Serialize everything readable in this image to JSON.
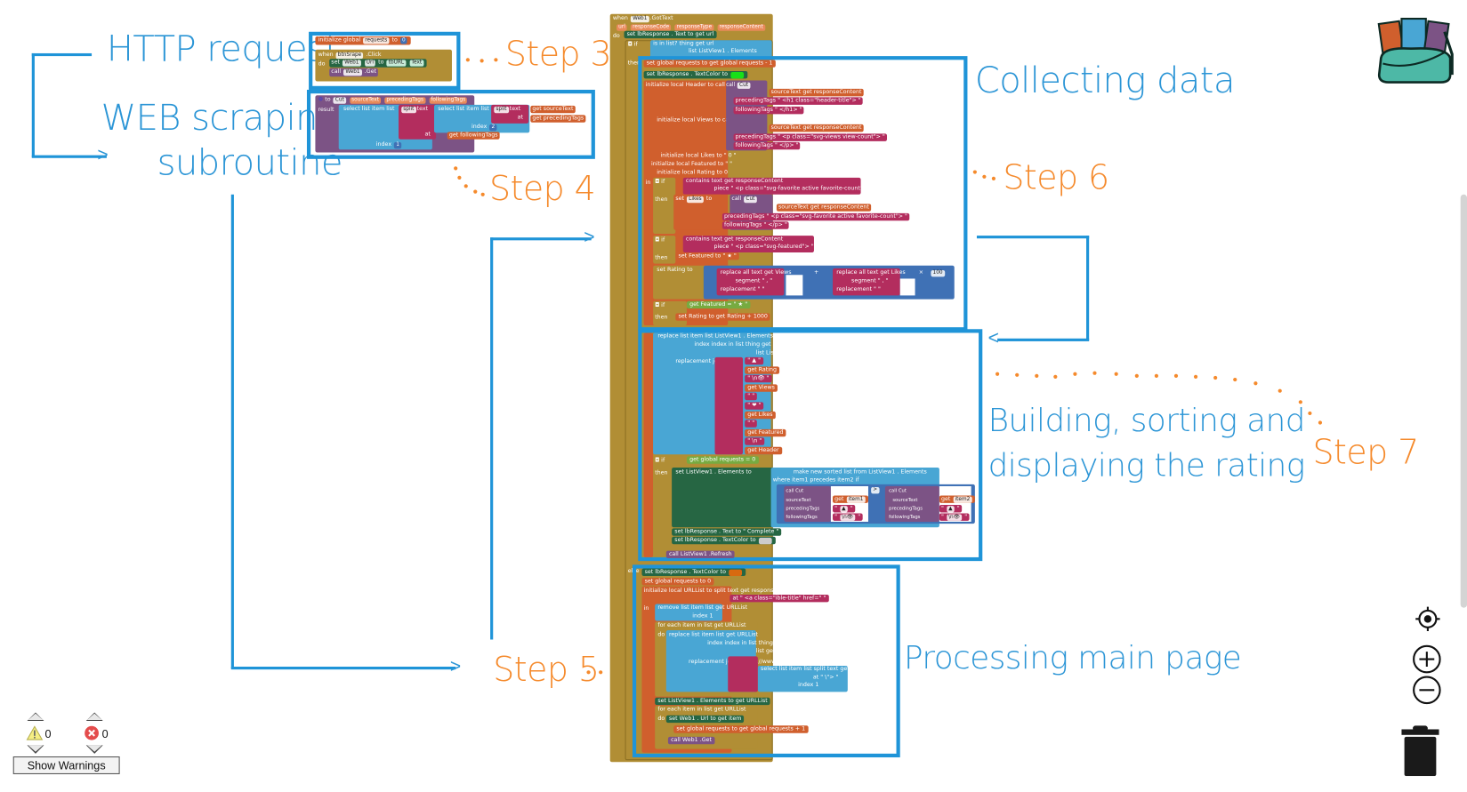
{
  "annotations": {
    "http_request": "HTTP request",
    "web_scraping_line1": "WEB scraping",
    "web_scraping_line2": "subroutine",
    "step3": "Step 3",
    "step4": "Step 4",
    "step5": "Step 5",
    "step6": "Step 6",
    "step7": "Step 7",
    "collecting_data": "Collecting data",
    "building_line1": "Building, sorting and",
    "building_line2": "displaying the rating",
    "processing_main_page": "Processing main page"
  },
  "colors": {
    "frame_blue": "#1f94d8",
    "step_orange": "#f58a2c",
    "control": "#b18e35",
    "variable": "#d05f2d",
    "procedure": "#7c5385",
    "list": "#49a6d4",
    "text": "#b32d5e",
    "math": "#3f71b5",
    "logic": "#77ab41",
    "component": "#266643"
  },
  "blocks": {
    "global_init": {
      "label": "initialize global",
      "var": "requests",
      "to": "to",
      "value": "0"
    },
    "btn_click": {
      "when": "when",
      "component": "btnSrape",
      "event": ".Click",
      "do": "do",
      "set": "set",
      "web": "Web1",
      "url": "Url",
      "to": "to",
      "tburl": "tbURL",
      "text": "Text",
      "call": "call",
      "get": ".Get"
    },
    "cut_proc": {
      "to": "to",
      "name": "Cut",
      "p1": "sourceText",
      "p2": "precedingTags",
      "p3": "followingTags",
      "result": "result",
      "select": "select list item  list",
      "split": "split",
      "text": "text",
      "index": "index",
      "at": "at",
      "get_source": "get sourceText",
      "get_preceding": "get precedingTags",
      "get_following": "get followingTags",
      "idx2": "2",
      "idx1": "1"
    },
    "gottext": {
      "when": "when",
      "component": "Web1",
      "event": ".GotText",
      "params": [
        "url",
        "responseCode",
        "responseType",
        "responseContent"
      ],
      "set_response_text": "set  lbResponse . Text  to  get url",
      "if_is_in_list": "is in list? thing  get url",
      "list_elements": "list  ListView1 . Elements",
      "set_global_requests": "set global requests to  get global requests  -  1",
      "set_text_color_green": "set  lbResponse . TextColor  to",
      "init_header": "initialize local Header to  call Cut",
      "header_source": "sourceText  get responseContent",
      "header_preceding": "precedingTags  \" <h1 class=\"header-title\"> \"",
      "header_following": "followingTags  \" </h1> \"",
      "init_views": "initialize local Views to  call Cut",
      "views_source": "sourceText  get responseContent",
      "views_preceding": "precedingTags  \" <p class=\"svg-views view-count\"> \"",
      "views_following": "followingTags  \" </p> \"",
      "init_likes": "initialize local Likes to \" 0 \"",
      "init_featured": "initialize local Featured to \" \"",
      "init_rating": "initialize local Rating to 0",
      "if_contains_likes": "contains text  get responseContent",
      "piece_likes": "piece  \" <p class=\"svg-favorite active favorite-count\"> \"",
      "set_likes": "set Likes to  call Cut",
      "likes_source": "sourceText  get responseContent",
      "likes_preceding": "precedingTags  \" <p class=\"svg-favorite active favorite-count\"> \"",
      "likes_following": "followingTags  \" </p> \"",
      "if_contains_featured": "contains text  get responseContent",
      "piece_featured": "piece  \" <p class=\"svg-featured\"> \"",
      "set_featured": "set Featured to \" ★ \"",
      "set_rating": "set Rating to",
      "replace_views": "replace all text  get Views",
      "replace_likes": "replace all text  get Likes",
      "segment": "segment \" , \"",
      "replacement": "replacement \" \"",
      "multiplier": "100",
      "if_featured": "get Featured  =  \" ★ \"",
      "rating_bonus": "set Rating to  get Rating  +  1000",
      "replace_list_item": "replace list item  list  ListView1 . Elements",
      "index_in_list": "index  index in list  thing  get url",
      "list2": "list  ListView1 . Elements",
      "replacement_join": "replacement  join",
      "join_items": [
        "\" ▲ \"",
        "get Rating",
        "\" \\n👁 \"",
        "get Views",
        "\" \"",
        "\" ❤ \"",
        "get Likes",
        "\" \"",
        "get Featured",
        "\" \\n \"",
        "get Header"
      ],
      "if_requests_zero": "get global requests  =  0",
      "set_sorted": "set  ListView1 . Elements  to",
      "make_sorted": "make new sorted list from  ListView1 . Elements",
      "where": "where  item1  precedes  item2  if",
      "cut_item1": "call Cut  sourceText get item1  precedingTags \" ▲ \"  followingTags \" \\n👁 \"",
      "compare": ">",
      "cut_item2": "call Cut  sourceText get item2  precedingTags \" ▲ \"  followingTags \" \\n👁 \"",
      "set_complete": "set  lbResponse . Text  to \" Complete \"",
      "set_color_gray": "set  lbResponse . TextColor  to",
      "refresh": "call  ListView1 .Refresh",
      "else_color_orange": "set  lbResponse . TextColor  to",
      "else_requests": "set global requests to 0",
      "init_urllist": "initialize local URLList to  split text  get responseContent",
      "urllist_at": "at  \" <a class=\"ible-title\" href=\" \"",
      "remove_item": "remove list item  list  get URLList",
      "remove_index": "index 1",
      "for_each1": "for each item in list  get URLList",
      "replace_urllist": "replace list item  list  get URLList",
      "urllist_index": "index  index in list  thing  get item",
      "urllist_list": "list  get URLList",
      "urllist_join": "replacement  join  \" https://www.instructables.com \"",
      "urllist_select": "select list item  list  split text  get item",
      "urllist_at2": "at  \" \\\"> \"",
      "urllist_index2": "index 1",
      "set_listview": "set  ListView1 . Elements  to  get URLList",
      "for_each2": "for each item in list  get URLList",
      "set_web_url": "set  Web1 . Url  to  get item",
      "set_requests_plus": "set global requests to  get global requests  +  1",
      "web_get": "call  Web1 .Get"
    }
  },
  "warnings": {
    "warning_count": "0",
    "error_count": "0",
    "show_warnings_label": "Show Warnings"
  },
  "workspace_controls": {
    "recenter": "recenter-icon",
    "zoom_in": "zoom-in-icon",
    "zoom_out": "zoom-out-icon",
    "trash": "trash-icon",
    "backpack": "backpack-icon"
  }
}
